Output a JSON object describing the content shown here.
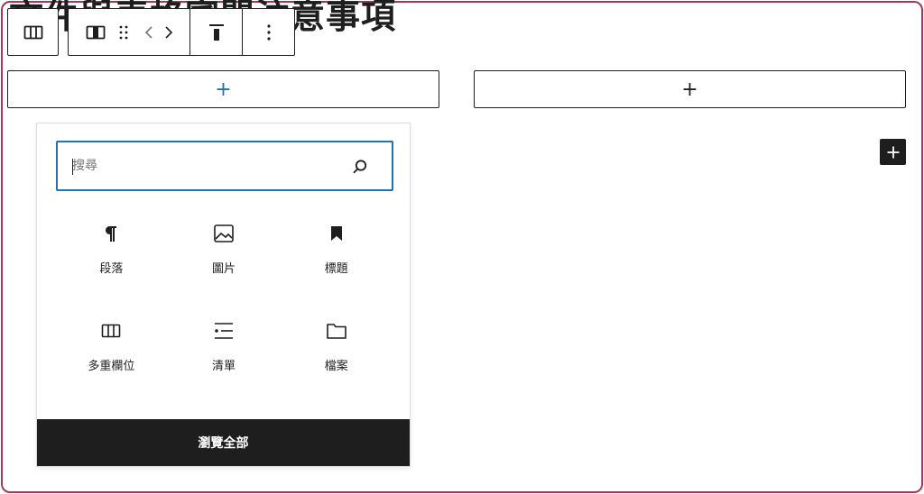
{
  "heading": {
    "text": "文件與表格審閱注意事項"
  },
  "toolbar": {
    "columns_icon": "columns-icon",
    "column_icon": "column-icon",
    "drag_icon": "drag-handle-icon",
    "prev_icon": "chevron-left-icon",
    "next_icon": "chevron-right-icon",
    "align_icon": "align-top-icon",
    "more_icon": "more-vertical-icon"
  },
  "appenders": {
    "left_label": "+",
    "right_label": "+"
  },
  "inserter": {
    "search": {
      "placeholder": "搜尋",
      "value": ""
    },
    "blocks": [
      {
        "label": "段落",
        "icon": "paragraph-icon"
      },
      {
        "label": "圖片",
        "icon": "image-icon"
      },
      {
        "label": "標題",
        "icon": "heading-bookmark-icon"
      },
      {
        "label": "多重欄位",
        "icon": "columns-icon"
      },
      {
        "label": "清單",
        "icon": "list-icon"
      },
      {
        "label": "檔案",
        "icon": "folder-icon"
      }
    ],
    "browse_all": "瀏覽全部"
  },
  "colors": {
    "border_frame": "#9b3a5e",
    "focus": "#2271b1",
    "dark": "#1e1e1e"
  }
}
